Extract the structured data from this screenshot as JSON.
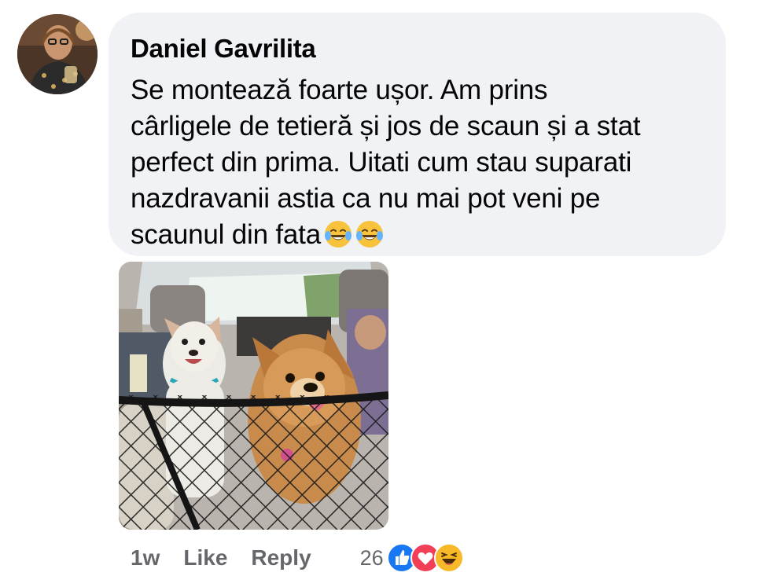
{
  "comment": {
    "author": "Daniel Gavrilita",
    "text": "Se montează foarte ușor. Am prins\ncârligele de tetieră și jos de scaun și a stat\nperfect din prima. Uitati cum stau suparati\nnazdravanii astia ca nu mai pot veni pe\nscaunul din fata",
    "inline_emojis": [
      "laughing-tears-emoji",
      "laughing-tears-emoji"
    ]
  },
  "attachment": {
    "type": "photo",
    "subject": "two-dogs-behind-car-seat-net"
  },
  "actions": {
    "timestamp": "1w",
    "like_label": "Like",
    "reply_label": "Reply"
  },
  "reactions": {
    "count": "26",
    "icons": [
      "like-reaction-icon",
      "love-reaction-icon",
      "haha-reaction-icon"
    ],
    "colors": {
      "like": "#1877f2",
      "love": "#f33e58",
      "haha": "#f7b928"
    }
  },
  "colors": {
    "bubble_bg": "#f0f2f5",
    "text": "#050505",
    "meta_text": "#65676b"
  }
}
